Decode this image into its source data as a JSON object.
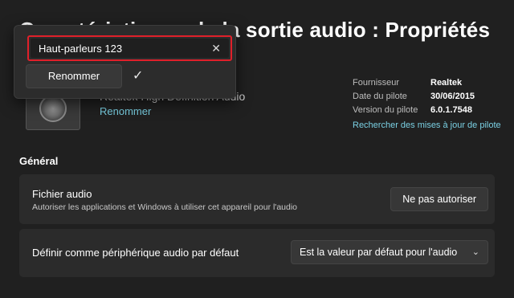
{
  "page": {
    "title": "Caractéristiques de la sortie audio : Propriétés"
  },
  "device": {
    "name": "Realtek High Definition Audio",
    "rename_link": "Renommer",
    "thumbnail_icon": "speaker-icon"
  },
  "properties": [
    {
      "label": "Fournisseur",
      "value": "Realtek"
    },
    {
      "label": "Date du pilote",
      "value": "30/06/2015"
    },
    {
      "label": "Version du pilote",
      "value": "6.0.1.7548"
    }
  ],
  "driver_update_link": "Rechercher des mises à jour de pilote",
  "general": {
    "section_label": "Général",
    "audio_file": {
      "title": "Fichier audio",
      "subtitle": "Autoriser les applications et Windows à utiliser cet appareil pour l'audio",
      "button": "Ne pas autoriser"
    },
    "default_device": {
      "title": "Définir comme périphérique audio par défaut",
      "selected": "Est la valeur par défaut pour l'audio"
    }
  },
  "rename_flyout": {
    "input_value": "Haut-parleurs 123",
    "clear_icon": "close-icon",
    "rename_button": "Renommer",
    "confirm_icon": "checkmark-icon"
  },
  "colors": {
    "background": "#202020",
    "card": "#2b2b2b",
    "accent_link": "#7ad0e3",
    "highlight_border": "#e0202a"
  }
}
